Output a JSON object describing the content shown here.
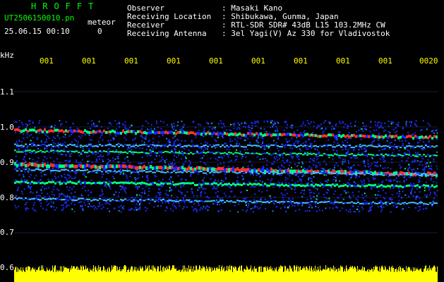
{
  "brand": "HROFFT",
  "file": {
    "name": "UT2506150010.pn",
    "suffix": "meteor",
    "datetime": "25.06.15 00:10",
    "count": "0"
  },
  "header": [
    {
      "label": "Observer",
      "value": ": Masaki Kano"
    },
    {
      "label": "Receiving Location",
      "value": ": Shibukawa, Gunma, Japan"
    },
    {
      "label": "Receiver",
      "value": ": RTL-SDR SDR# 43dB L15 103.2MHz CW"
    },
    {
      "label": "Receiving Antenna",
      "value": ": 3el Yagi(V) Az 330 for Vladivostok"
    }
  ],
  "axis": {
    "unit": "kHz",
    "y_ticks": [
      "1.1",
      "1.0",
      "0.9",
      "0.8",
      "0.7",
      "0.6"
    ],
    "x_ticks": [
      "001",
      "001",
      "001",
      "001",
      "001",
      "001",
      "001",
      "001",
      "001",
      "0020"
    ]
  },
  "colors": {
    "background": "#000000",
    "header_text": "#ffffff",
    "brand": "#00ff00",
    "time_ticks": "#ffff00",
    "noise_floor": "#ffff00",
    "signal_strong": "#ff3030",
    "signal_mid": "#00ff80",
    "noise": "#1a2cff"
  }
}
